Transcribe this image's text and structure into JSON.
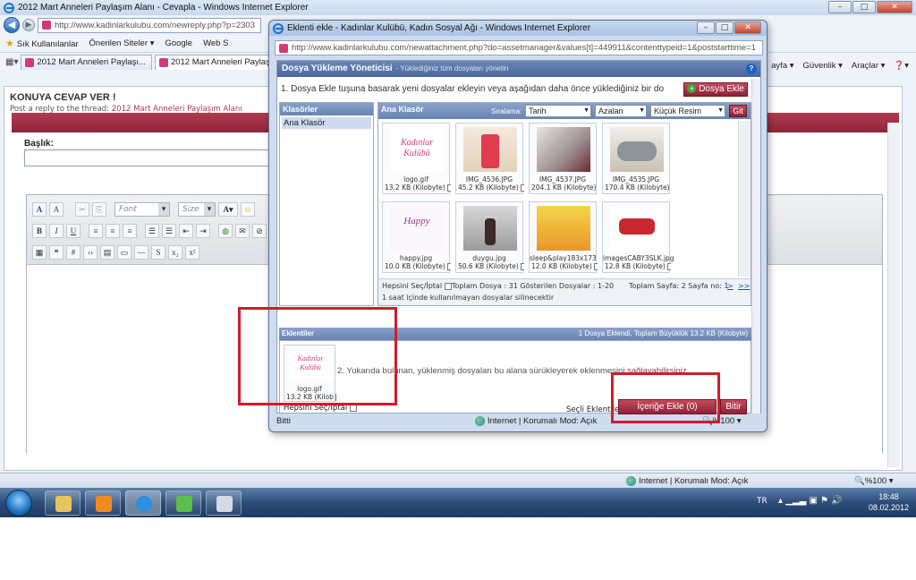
{
  "bg_window": {
    "title": "2012 Mart Anneleri Paylaşım Alanı - Cevapla - Windows Internet Explorer",
    "address": "http://www.kadinlarkulubu.com/newreply.php?p=2303",
    "favorites": {
      "favorites_label": "Sık Kullanılanlar",
      "suggested": "Önerilen Siteler ▾",
      "google": "Google",
      "web": "Web S"
    },
    "tabs": [
      "2012 Mart Anneleri Paylaşı...",
      "2012 Mart Anneleri Paylaşı..."
    ],
    "tools": {
      "page": "ayfa ▾",
      "security": "Güvenlik ▾",
      "tools": "Araçlar ▾",
      "help": "❓▾"
    },
    "reply_title": "KONUYA CEVAP VER !",
    "reply_sub_prefix": "Post a reply to the thread:",
    "reply_sub_link": "2012 Mart Anneleri Paylaşım Alanı",
    "title_label": "Başlık:",
    "editor": {
      "font": "Font",
      "size": "Size",
      "bold": "B",
      "italic": "I",
      "underline": "U",
      "sub": "x₂",
      "sup": "x²",
      "color": "A"
    },
    "status": {
      "zone": "Internet | Korumalı Mod: Açık",
      "zoom": "%100"
    }
  },
  "taskbar": {
    "lang": "TR",
    "time": "18:48",
    "date": "08.02.2012"
  },
  "popup": {
    "title": "Eklenti ekle - Kadınlar Kulübü, Kadın Sosyal Ağı - Windows Internet Explorer",
    "address": "http://www.kadinlarkulubu.com/newattachment.php?do=assetmanager&values[t]=449911&contenttypeid=1&poststarttime=1",
    "manager_title": "Dosya Yükleme Yöneticisi",
    "manager_subtitle": "- Yüklediğiniz tüm dosyaları yönetin",
    "instruction": "1. Dosya Ekle tuşuna basarak yeni dosyalar ekleyin veya aşağıdan daha önce yüklediğiniz bir dosyayı seçin",
    "add_file_button": "Dosya Ekle",
    "folders_header": "Klasörler",
    "folder_item": "Ana Klasör",
    "files_header": "Ana Klasör",
    "sort_label": "Sıralama:",
    "sort_field": "Tarih",
    "sort_order": "Azalan",
    "view_mode": "Küçük Resim",
    "go_button": "Git",
    "files": [
      {
        "name": "logo.gif",
        "size": "13.2 KB (Kilobyte)"
      },
      {
        "name": "IMG_4536.JPG",
        "size": "45.2 KB (Kilobyte)"
      },
      {
        "name": "IMG_4537.JPG",
        "size": "204.1 KB (Kilobyte)"
      },
      {
        "name": "IMG_4535.JPG",
        "size": "170.4 KB (Kilobyte)"
      },
      {
        "name": "happy.jpg",
        "size": "10.0 KB (Kilobyte)"
      },
      {
        "name": "duygu.jpg",
        "size": "50.6 KB (Kilobyte)"
      },
      {
        "name": "sleep&play183x173.gif",
        "size": "12.0 KB (Kilobyte)"
      },
      {
        "name": "imagesCABY3SLK.jpg",
        "size": "12.8 KB (Kilobyte)"
      }
    ],
    "select_all": "Hepsini Seç/İptal",
    "total_files": "Toplam Dosya : 31 Gösterilen Dosyalar : 1-20",
    "total_pages": "Toplam Sayfa: 2 Sayfa no: 1",
    "page_next": ">",
    "page_last": ">>",
    "delete_note": "1 saat içinde kullanılmayan dosyalar silinecektir",
    "attachments_header": "Eklentiler",
    "attachments_summary": "1 Dosya Eklendi, Toplam Büyüklük 13.2 KB (Kilobyte)",
    "attached_file": {
      "name": "logo.gif",
      "size": "13.2 KB (Kilob"
    },
    "drag_instruction": "2. Yukarıda bulunan, yüklenmiş dosyaları bu alana sürükleyerek eklenmesini sağlayabilirsiniz.",
    "attach_select_all": "Hepsini Seç/İptal",
    "selected_label": "Seçli Eklentiler",
    "insert_button": "İçeriğe Ekle (0)",
    "finish_button": "Bitir",
    "status_done": "Bitti",
    "status_zone": "Internet | Korumalı Mod: Açık",
    "status_zoom": "%100",
    "logo_text": "Kadınlar Kulübü"
  },
  "colors": {
    "accent_red": "#a8304a",
    "highlight_box": "#d11c2b",
    "header_blue": "#5a76ab"
  }
}
